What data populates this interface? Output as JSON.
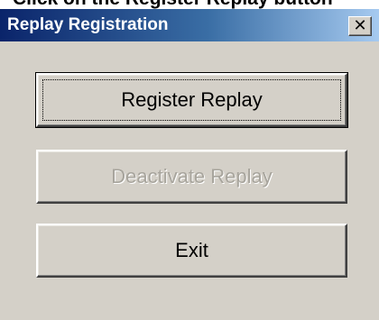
{
  "overlay_text": "Click on the Register Replay button",
  "window": {
    "title": "Replay Registration",
    "close_glyph": "✕"
  },
  "buttons": {
    "register": {
      "label": "Register Replay",
      "enabled": true,
      "default": true
    },
    "deactivate": {
      "label": "Deactivate Replay",
      "enabled": false
    },
    "exit": {
      "label": "Exit",
      "enabled": true
    }
  },
  "colors": {
    "dialog_face": "#d4d0c8",
    "titlebar_start": "#0a246a",
    "titlebar_end": "#a6caf0",
    "disabled_text": "#a7a49c"
  }
}
